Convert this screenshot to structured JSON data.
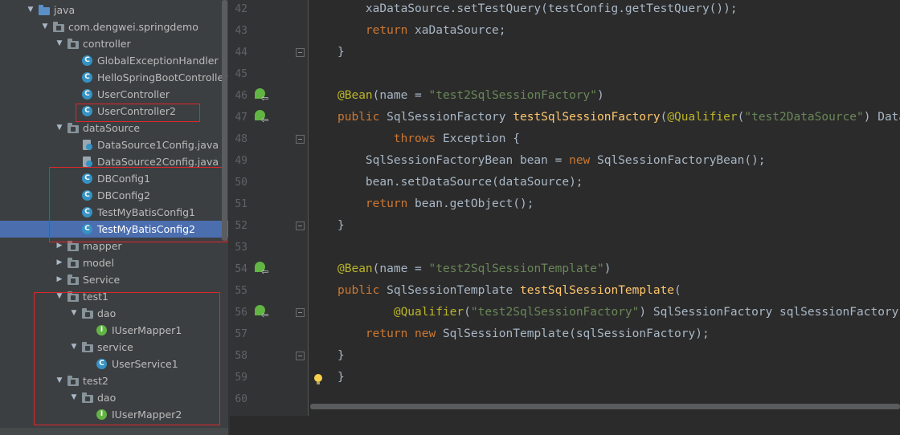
{
  "project_tree": {
    "nodes": [
      {
        "label": "java",
        "depth": 0,
        "expanded": true,
        "icon": "folder-blue-icon"
      },
      {
        "label": "com.dengwei.springdemo",
        "depth": 1,
        "expanded": true,
        "icon": "package-icon"
      },
      {
        "label": "controller",
        "depth": 2,
        "expanded": true,
        "icon": "package-icon"
      },
      {
        "label": "GlobalExceptionHandler",
        "depth": 3,
        "icon": "class-icon"
      },
      {
        "label": "HelloSpringBootController",
        "depth": 3,
        "icon": "class-icon"
      },
      {
        "label": "UserController",
        "depth": 3,
        "icon": "class-icon"
      },
      {
        "label": "UserController2",
        "depth": 3,
        "icon": "class-icon"
      },
      {
        "label": "dataSource",
        "depth": 2,
        "expanded": true,
        "icon": "package-icon"
      },
      {
        "label": "DataSource1Config.java",
        "depth": 3,
        "icon": "config-file-icon"
      },
      {
        "label": "DataSource2Config.java",
        "depth": 3,
        "icon": "config-file-icon"
      },
      {
        "label": "DBConfig1",
        "depth": 3,
        "icon": "class-icon"
      },
      {
        "label": "DBConfig2",
        "depth": 3,
        "icon": "class-icon"
      },
      {
        "label": "TestMyBatisConfig1",
        "depth": 3,
        "icon": "class-icon"
      },
      {
        "label": "TestMyBatisConfig2",
        "depth": 3,
        "icon": "class-icon",
        "selected": true
      },
      {
        "label": "mapper",
        "depth": 2,
        "expanded": false,
        "icon": "package-icon"
      },
      {
        "label": "model",
        "depth": 2,
        "expanded": false,
        "icon": "package-icon"
      },
      {
        "label": "Service",
        "depth": 2,
        "expanded": false,
        "icon": "package-icon"
      },
      {
        "label": "test1",
        "depth": 2,
        "expanded": true,
        "icon": "package-icon"
      },
      {
        "label": "dao",
        "depth": 3,
        "expanded": true,
        "icon": "package-icon"
      },
      {
        "label": "IUserMapper1",
        "depth": 4,
        "icon": "interface-icon"
      },
      {
        "label": "service",
        "depth": 3,
        "expanded": true,
        "icon": "package-icon"
      },
      {
        "label": "UserService1",
        "depth": 4,
        "icon": "class-icon"
      },
      {
        "label": "test2",
        "depth": 2,
        "expanded": true,
        "icon": "package-icon"
      },
      {
        "label": "dao",
        "depth": 3,
        "expanded": true,
        "icon": "package-icon"
      },
      {
        "label": "IUserMapper2",
        "depth": 4,
        "icon": "interface-icon"
      }
    ]
  },
  "editor": {
    "lines": [
      {
        "num": "42",
        "tokens": [
          [
            "",
            "    xaDataSource.setTestQuery(testConfig.getTestQuery());"
          ]
        ]
      },
      {
        "num": "43",
        "tokens": [
          [
            "kw",
            "    return "
          ],
          [
            "",
            "xaDataSource;"
          ]
        ]
      },
      {
        "num": "44",
        "tokens": [
          [
            "",
            "}"
          ]
        ]
      },
      {
        "num": "45",
        "tokens": []
      },
      {
        "num": "46",
        "tokens": [
          [
            "ann",
            "@Bean"
          ],
          [
            "",
            "(name = "
          ],
          [
            "str",
            "\"test2SqlSessionFactory\""
          ],
          [
            "",
            ")"
          ]
        ]
      },
      {
        "num": "47",
        "tokens": [
          [
            "kw",
            "public "
          ],
          [
            "",
            "SqlSessionFactory "
          ],
          [
            "fn",
            "testSqlSessionFactory"
          ],
          [
            "",
            "("
          ],
          [
            "ann",
            "@Qualifier"
          ],
          [
            "",
            "("
          ],
          [
            "str",
            "\"test2DataSource\""
          ],
          [
            "",
            ") DataSource dataSource)"
          ]
        ]
      },
      {
        "num": "48",
        "tokens": [
          [
            "kw",
            "        throws "
          ],
          [
            "",
            "Exception {"
          ]
        ]
      },
      {
        "num": "49",
        "tokens": [
          [
            "",
            "    SqlSessionFactoryBean bean = "
          ],
          [
            "kw",
            "new "
          ],
          [
            "",
            "SqlSessionFactoryBean();"
          ]
        ]
      },
      {
        "num": "50",
        "tokens": [
          [
            "",
            "    bean.setDataSource(dataSource);"
          ]
        ]
      },
      {
        "num": "51",
        "tokens": [
          [
            "kw",
            "    return "
          ],
          [
            "",
            "bean.getObject();"
          ]
        ]
      },
      {
        "num": "52",
        "tokens": [
          [
            "",
            "}"
          ]
        ]
      },
      {
        "num": "53",
        "tokens": []
      },
      {
        "num": "54",
        "tokens": [
          [
            "ann",
            "@Bean"
          ],
          [
            "",
            "(name = "
          ],
          [
            "str",
            "\"test2SqlSessionTemplate\""
          ],
          [
            "",
            ")"
          ]
        ]
      },
      {
        "num": "55",
        "tokens": [
          [
            "kw",
            "public "
          ],
          [
            "",
            "SqlSessionTemplate "
          ],
          [
            "fn",
            "testSqlSessionTemplate"
          ],
          [
            "",
            "("
          ]
        ]
      },
      {
        "num": "56",
        "tokens": [
          [
            "ann",
            "        @Qualifier"
          ],
          [
            "",
            "("
          ],
          [
            "str",
            "\"test2SqlSessionFactory\""
          ],
          [
            "",
            ") SqlSessionFactory sqlSessionFactory)"
          ]
        ]
      },
      {
        "num": "57",
        "tokens": [
          [
            "kw",
            "    return new "
          ],
          [
            "",
            "SqlSessionTemplate(sqlSessionFactory);"
          ]
        ]
      },
      {
        "num": "58",
        "tokens": [
          [
            "",
            "}"
          ]
        ]
      },
      {
        "num": "59",
        "tokens": [
          [
            "",
            "}"
          ]
        ]
      },
      {
        "num": "60",
        "tokens": []
      }
    ],
    "gutter_bean_lines": [
      "46",
      "47",
      "54",
      "56"
    ],
    "fold_lines": [
      "44",
      "48",
      "52",
      "56",
      "58"
    ]
  },
  "colors": {
    "keyword": "#cc7832",
    "annotation": "#bbb529",
    "string": "#6a8759",
    "method": "#ffc66d",
    "selection": "#4b6eaf",
    "highlight_box": "#e0262b"
  }
}
